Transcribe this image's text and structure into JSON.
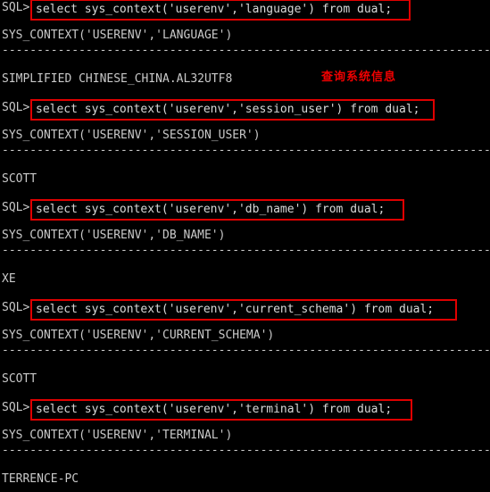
{
  "terminal": {
    "title": "SQL*Plus session",
    "prompt": "SQL>",
    "foreground_color": "#c9c9c9",
    "background_color": "#000000",
    "highlight_border_color": "#e00000",
    "annotation_color": "#f00000",
    "separator": "---------------------------------------------------------------------------"
  },
  "annotation": {
    "text": "查询系统信息"
  },
  "blocks": [
    {
      "prompt": "SQL>",
      "command": "select sys_context('userenv','language') from dual;",
      "header": "SYS_CONTEXT('USERENV','LANGUAGE')",
      "result": "SIMPLIFIED CHINESE_CHINA.AL32UTF8"
    },
    {
      "prompt": "SQL>",
      "command": "select sys_context('userenv','session_user') from dual;",
      "header": "SYS_CONTEXT('USERENV','SESSION_USER')",
      "result": "SCOTT"
    },
    {
      "prompt": "SQL>",
      "command": "select sys_context('userenv','db_name') from dual;",
      "header": "SYS_CONTEXT('USERENV','DB_NAME')",
      "result": "XE"
    },
    {
      "prompt": "SQL>",
      "command": "select sys_context('userenv','current_schema') from dual;",
      "header": "SYS_CONTEXT('USERENV','CURRENT_SCHEMA')",
      "result": "SCOTT"
    },
    {
      "prompt": "SQL>",
      "command": "select sys_context('userenv','terminal') from dual;",
      "header": "SYS_CONTEXT('USERENV','TERMINAL')",
      "result": "TERRENCE-PC"
    }
  ]
}
